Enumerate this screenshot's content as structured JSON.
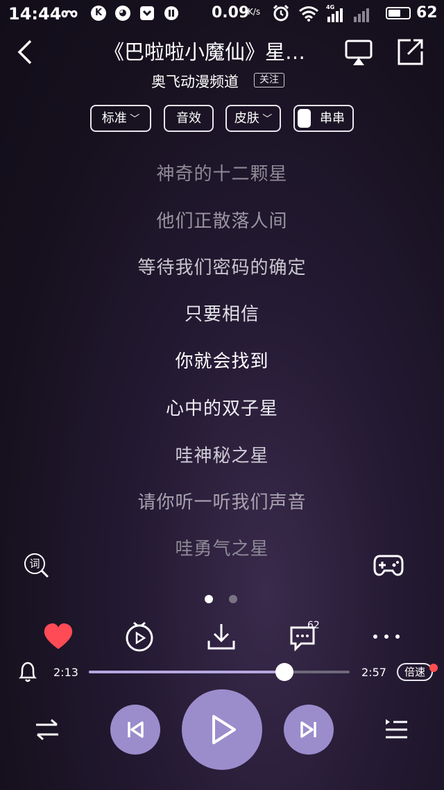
{
  "status_bar": {
    "time": "14:44",
    "net_speed": "0.09",
    "net_unit": "K/s",
    "signal_label": "4G",
    "battery_percent": "62",
    "battery_level": 0.62,
    "app_icons": [
      "infinity-icon",
      "k-icon",
      "face-icon",
      "pocket-icon",
      "pause-icon"
    ]
  },
  "header": {
    "title": "《巴啦啦小魔仙》星…",
    "channel": "奥飞动漫频道",
    "follow_label": "关注"
  },
  "chips": [
    {
      "label": "标准",
      "has_chevron": true
    },
    {
      "label": "音效",
      "has_chevron": false
    },
    {
      "label": "皮肤",
      "has_chevron": true
    },
    {
      "label": "串串",
      "has_toggle": true
    }
  ],
  "lyrics": [
    "神奇的十二颗星",
    "他们正散落人间",
    "等待我们密码的确定",
    "只要相信",
    "你就会找到",
    "心中的双子星",
    "哇神秘之星",
    "请你听一听我们声音",
    "哇勇气之星"
  ],
  "lyric_search_label": "词",
  "pagination": {
    "pages": 2,
    "current": 1
  },
  "actions": {
    "comment_count": "62"
  },
  "progress": {
    "current_time": "2:13",
    "total_time": "2:57",
    "fraction": 0.751,
    "speed_label": "倍速"
  },
  "colors": {
    "accent": "#9b8dcc",
    "like": "#ff4b55",
    "progress_fill": "#b4a6de",
    "badge_dot": "#ff4d4f"
  }
}
